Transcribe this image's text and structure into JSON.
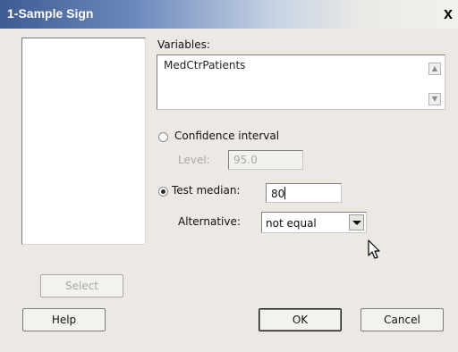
{
  "window": {
    "title": "1-Sample Sign",
    "close_glyph": "x"
  },
  "variables": {
    "label": "Variables:",
    "value": "MedCtrPatients"
  },
  "confidence": {
    "label": "Confidence interval",
    "selected": false,
    "level_label": "Level:",
    "level_value": "95.0"
  },
  "test_median": {
    "label": "Test median:",
    "selected": true,
    "value": "80"
  },
  "alternative": {
    "label": "Alternative:",
    "selected": "not equal"
  },
  "buttons": {
    "select": "Select",
    "help": "Help",
    "ok": "OK",
    "cancel": "Cancel"
  },
  "icons": {
    "close": "close-icon",
    "scroll_up": "scroll-up-icon",
    "scroll_down": "scroll-down-icon",
    "dropdown": "chevron-down-icon",
    "cursor": "mouse-pointer-icon"
  }
}
